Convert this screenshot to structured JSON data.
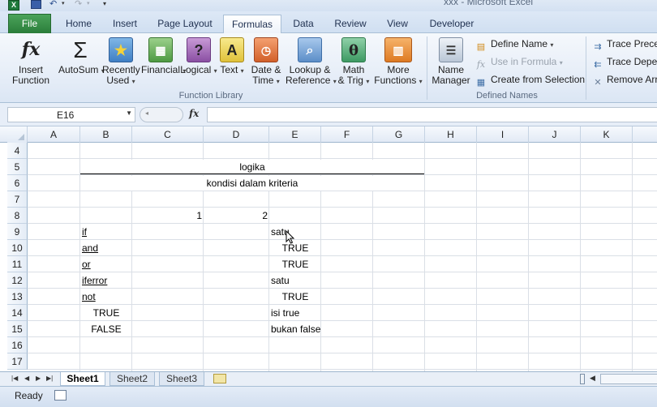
{
  "window": {
    "title": "xxx - Microsoft Excel",
    "app_icon_glyph": "X",
    "quick_access": {
      "save_icon": "save-icon",
      "undo_icon": "undo-icon",
      "redo_icon": "redo-icon"
    }
  },
  "tabs": {
    "file": "File",
    "home": "Home",
    "insert": "Insert",
    "page_layout": "Page Layout",
    "formulas": "Formulas",
    "data": "Data",
    "review": "Review",
    "view": "View",
    "developer": "Developer"
  },
  "ribbon": {
    "function_library": {
      "label": "Function Library",
      "insert_function": [
        "Insert",
        "Function"
      ],
      "autosum": "AutoSum",
      "recently_used": [
        "Recently",
        "Used"
      ],
      "financial": "Financial",
      "logical": "Logical",
      "text": "Text",
      "date_time": [
        "Date &",
        "Time"
      ],
      "lookup_reference": [
        "Lookup &",
        "Reference"
      ],
      "math_trig": [
        "Math",
        "& Trig"
      ],
      "more_functions": [
        "More",
        "Functions"
      ]
    },
    "defined_names": {
      "label": "Defined Names",
      "name_manager": [
        "Name",
        "Manager"
      ],
      "define_name": "Define Name",
      "use_in_formula": "Use in Formula",
      "create_from_selection": "Create from Selection"
    },
    "formula_auditing": {
      "trace_precedents": "Trace Precedents",
      "trace_dependents": "Trace Dependents",
      "remove_arrows": "Remove Arrows"
    }
  },
  "formula_bar": {
    "name_box": "E16",
    "fx_label": "fx",
    "formula": ""
  },
  "grid": {
    "columns": [
      "A",
      "B",
      "C",
      "D",
      "E",
      "F",
      "G",
      "H",
      "I",
      "J",
      "K"
    ],
    "rows": [
      "4",
      "5",
      "6",
      "7",
      "8",
      "9",
      "10",
      "11",
      "12",
      "13",
      "14",
      "15",
      "16",
      "17"
    ],
    "cells": {
      "title": "logika",
      "subtitle": "kondisi dalam kriteria",
      "c8": "1",
      "d8": "2",
      "b9": "if",
      "b10": "and",
      "b11": "or",
      "b12": "iferror",
      "b13": "not",
      "b14": "TRUE",
      "b15": "FALSE",
      "e9": "satu",
      "e10": "TRUE",
      "e11": "TRUE",
      "e12": "satu",
      "e13": "TRUE",
      "e14": "isi true",
      "e15": "bukan false"
    }
  },
  "sheets": [
    "Sheet1",
    "Sheet2",
    "Sheet3"
  ],
  "status": {
    "mode": "Ready"
  }
}
